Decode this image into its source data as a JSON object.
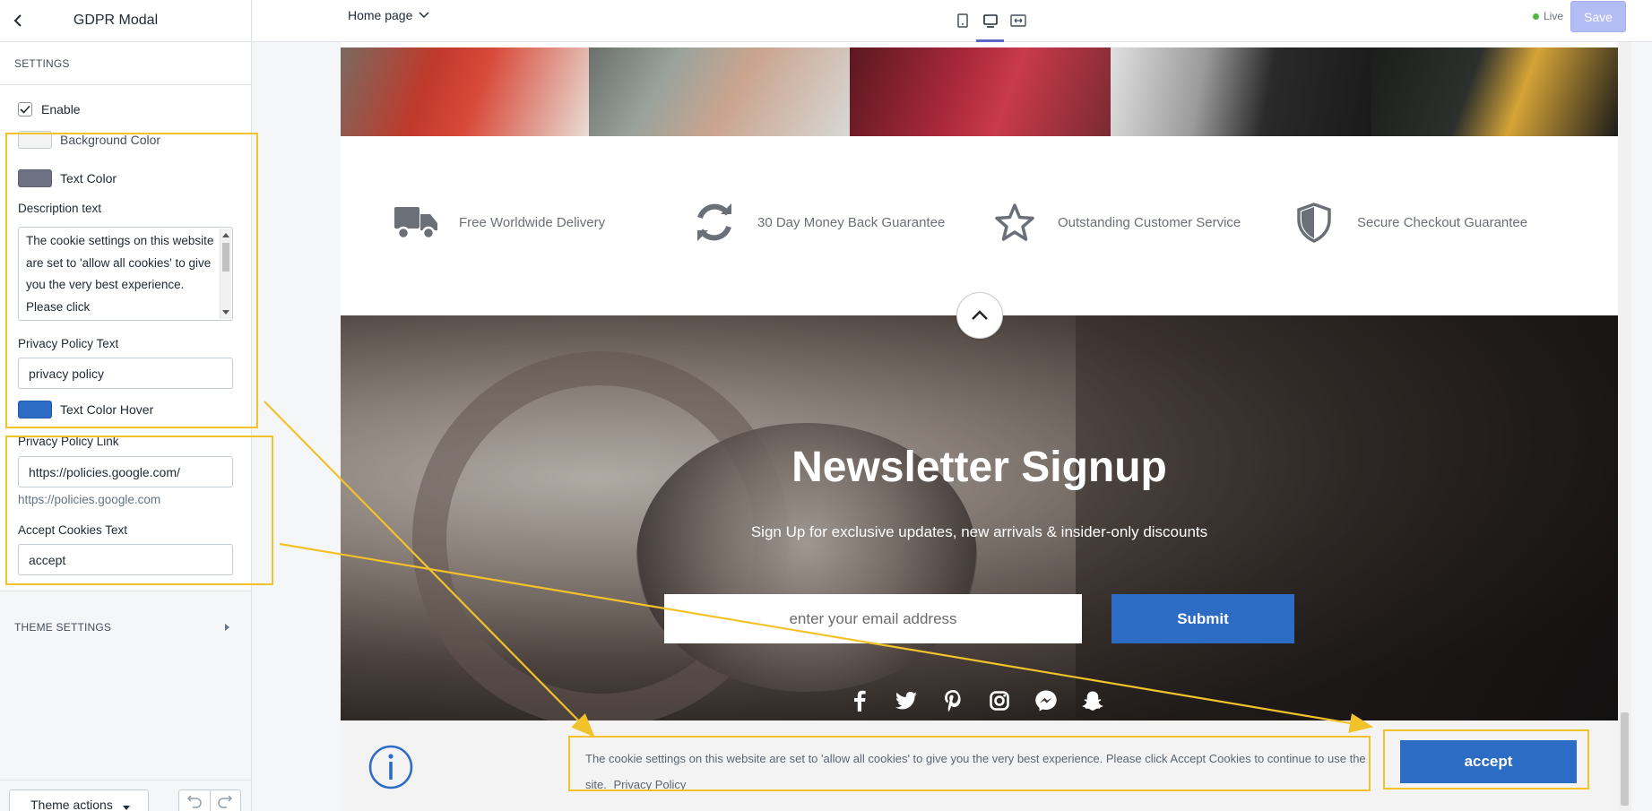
{
  "app": {
    "section_title": "GDPR Modal",
    "page_selector": "Home page",
    "live_label": "Live",
    "save_label": "Save"
  },
  "settings": {
    "header": "SETTINGS",
    "enable_label": "Enable",
    "background_color_label": "Background Color",
    "background_color_value": "#f3f3f3",
    "text_color_label": "Text Color",
    "text_color_value": "#6e7083",
    "description_label": "Description text",
    "description_value": "The cookie settings on this website are set to 'allow all cookies' to give you the very best experience. Please click",
    "privacy_text_label": "Privacy Policy Text",
    "privacy_text_value": "privacy policy",
    "text_color_hover_label": "Text Color Hover",
    "text_color_hover_value": "#2d6cc4",
    "privacy_link_label": "Privacy Policy Link",
    "privacy_link_value": "https://policies.google.com/",
    "privacy_link_helper": "https://policies.google.com",
    "accept_text_label": "Accept Cookies Text",
    "accept_text_value": "accept",
    "theme_settings_label": "THEME SETTINGS",
    "theme_actions_label": "Theme actions"
  },
  "preview": {
    "features": [
      {
        "icon": "truck-icon",
        "label": "Free Worldwide Delivery"
      },
      {
        "icon": "refresh-icon",
        "label": "30 Day Money Back Guarantee"
      },
      {
        "icon": "star-icon",
        "label": "Outstanding Customer Service"
      },
      {
        "icon": "shield-icon",
        "label": "Secure Checkout Guarantee"
      }
    ],
    "newsletter_title": "Newsletter Signup",
    "newsletter_subtitle": "Sign Up for exclusive updates, new arrivals & insider-only discounts",
    "email_placeholder": "enter your email address",
    "submit_label": "Submit",
    "socials": [
      "facebook-icon",
      "twitter-icon",
      "pinterest-icon",
      "instagram-icon",
      "messenger-icon",
      "snapchat-icon"
    ],
    "cookie_text": "The cookie settings on this website are set to 'allow all cookies' to give you the very best experience. Please click Accept Cookies to continue to use the site.",
    "cookie_link": "Privacy Policy",
    "accept_label": "accept"
  },
  "colors": {
    "accent": "#2d6cc4",
    "highlight": "#f2c22b",
    "save_disabled": "#b3bcf5"
  }
}
